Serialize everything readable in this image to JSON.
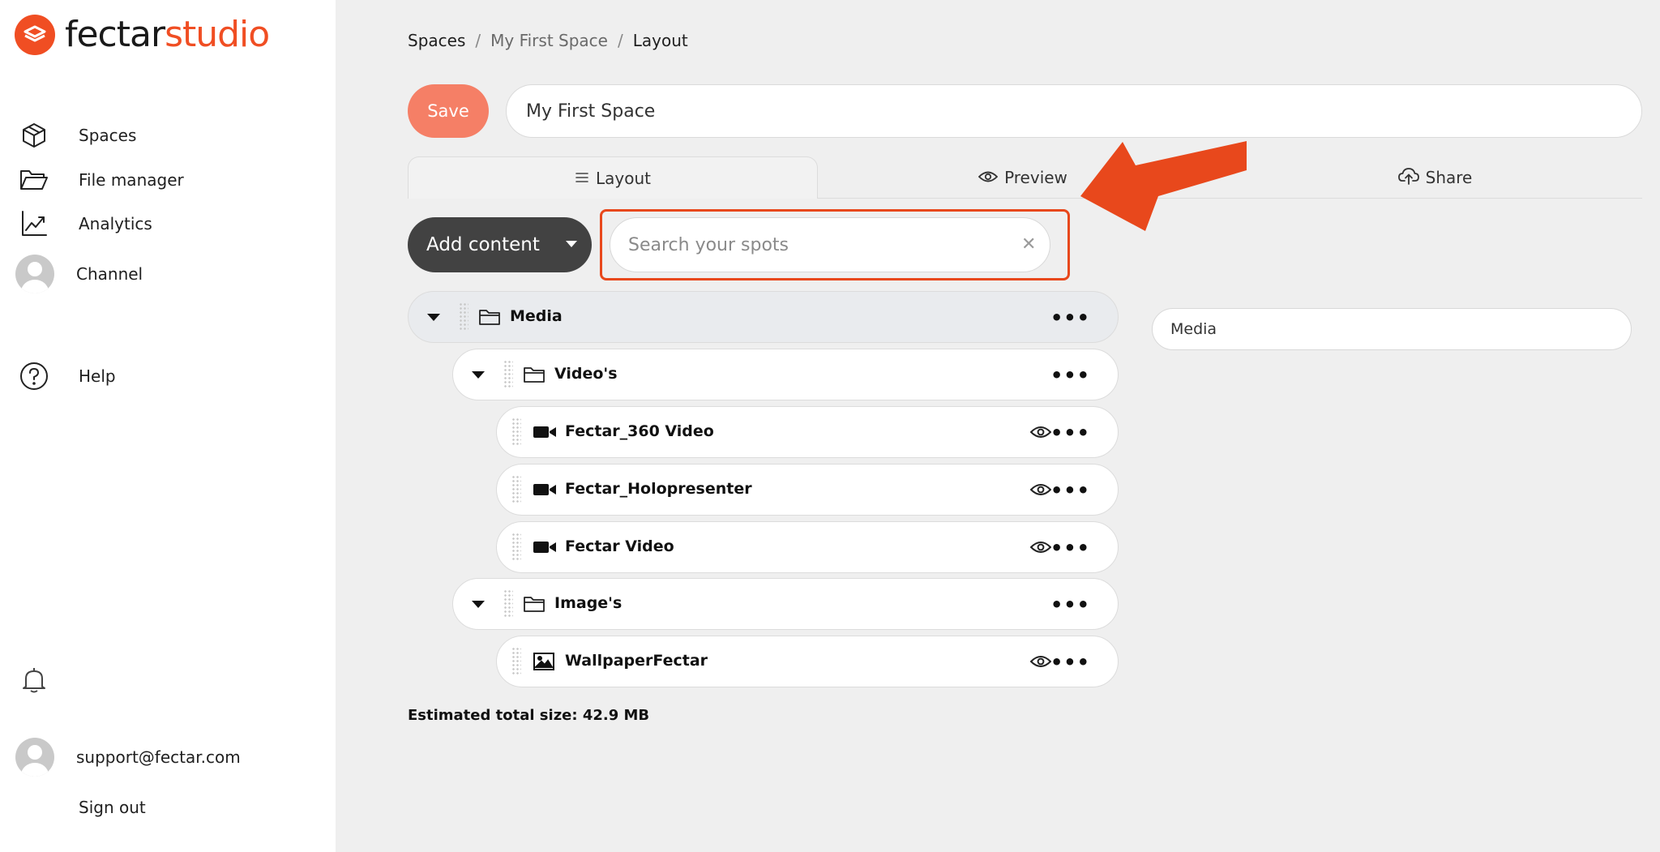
{
  "brand": {
    "name_a": "fectar",
    "name_b": "studio",
    "accent": "#f04e23"
  },
  "sidebar": {
    "items": [
      {
        "label": "Spaces",
        "icon": "cube-icon"
      },
      {
        "label": "File manager",
        "icon": "folder-open-icon"
      },
      {
        "label": "Analytics",
        "icon": "chart-line-icon"
      },
      {
        "label": "Channel",
        "icon": "avatar"
      },
      {
        "label": "Help",
        "icon": "help-icon"
      }
    ],
    "bell_icon": "bell-icon",
    "user_email": "support@fectar.com",
    "sign_out": "Sign out"
  },
  "breadcrumb": {
    "root": "Spaces",
    "space": "My First Space",
    "current": "Layout",
    "separator": "/"
  },
  "header": {
    "save_label": "Save",
    "space_name": "My First Space"
  },
  "tabs": [
    {
      "label": "Layout",
      "icon": "list-icon",
      "active": true
    },
    {
      "label": "Preview",
      "icon": "eye-icon",
      "active": false
    },
    {
      "label": "Share",
      "icon": "cloud-upload-icon",
      "active": false
    }
  ],
  "toolbar": {
    "add_content_label": "Add content",
    "search_placeholder": "Search your spots",
    "clear_symbol": "✕"
  },
  "tree": [
    {
      "label": "Media",
      "type": "folder",
      "level": 0
    },
    {
      "label": "Video's",
      "type": "folder",
      "level": 1
    },
    {
      "label": "Fectar_360 Video",
      "type": "video",
      "level": 2
    },
    {
      "label": "Fectar_Holopresenter",
      "type": "video",
      "level": 2
    },
    {
      "label": "Fectar Video",
      "type": "video",
      "level": 2
    },
    {
      "label": "Image's",
      "type": "folder",
      "level": 1
    },
    {
      "label": "WallpaperFectar",
      "type": "image",
      "level": 2
    }
  ],
  "menu_symbol": "•••",
  "footer": {
    "total_size": "Estimated total size: 42.9 MB"
  },
  "detail": {
    "name_value": "Media"
  }
}
